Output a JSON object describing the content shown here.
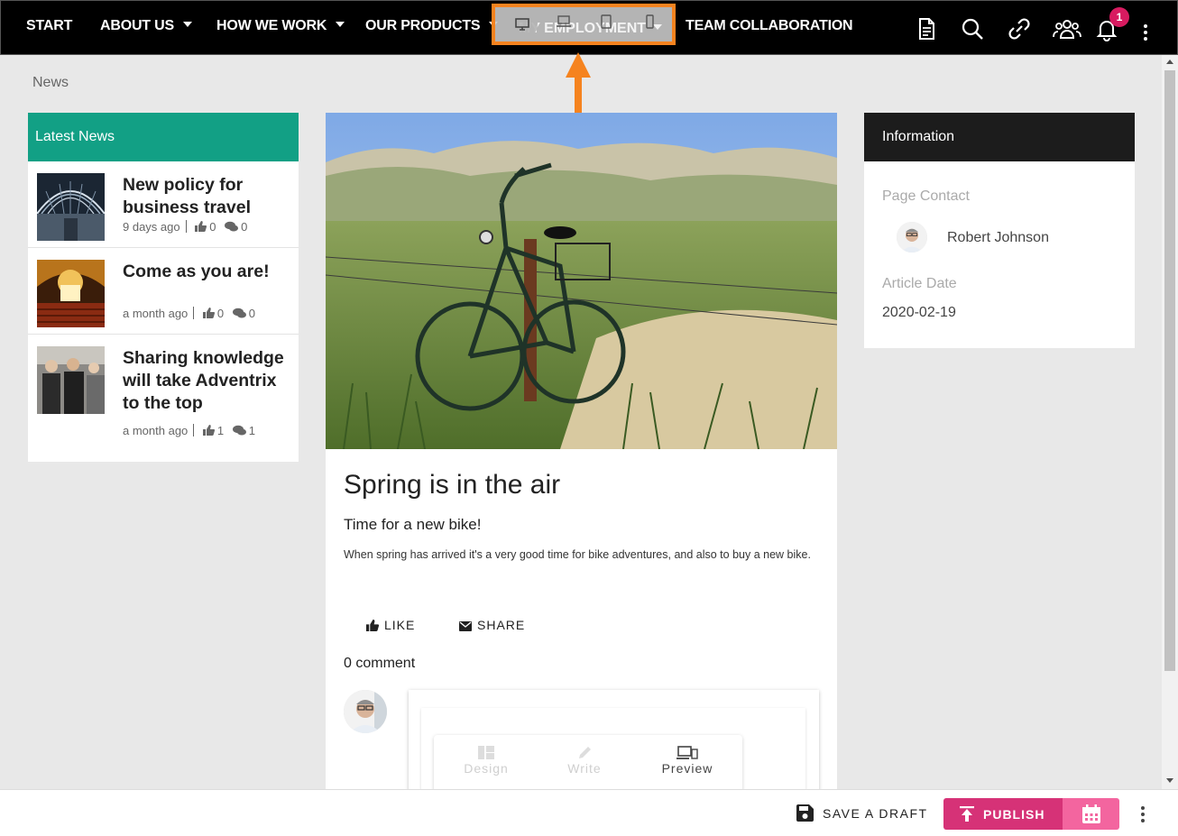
{
  "nav": {
    "items": [
      {
        "label": "START",
        "dropdown": false
      },
      {
        "label": "ABOUT US",
        "dropdown": true
      },
      {
        "label": "HOW WE WORK",
        "dropdown": true
      },
      {
        "label": "OUR PRODUCTS",
        "dropdown": true
      },
      {
        "label": "MY EMPLOYMENT",
        "dropdown": true
      },
      {
        "label": "TEAM COLLABORATION",
        "dropdown": false
      }
    ],
    "notification_count": "1",
    "icons": [
      "document-icon",
      "search-icon",
      "link-icon",
      "people-icon",
      "bell-icon",
      "more-vertical-icon"
    ],
    "device_switcher": [
      "desktop-icon",
      "laptop-icon",
      "tablet-icon",
      "phone-icon"
    ]
  },
  "breadcrumb": "News",
  "latest_news": {
    "title": "Latest News",
    "items": [
      {
        "title": "New policy for business travel",
        "time": "9 days ago",
        "likes": "0",
        "comments": "0"
      },
      {
        "title": "Come as you are!",
        "time": "a month ago",
        "likes": "0",
        "comments": "0"
      },
      {
        "title": "Sharing knowledge will take Adventrix to the top",
        "time": "a month ago",
        "likes": "1",
        "comments": "1"
      }
    ]
  },
  "article": {
    "title": "Spring is in the air",
    "subtitle": "Time for a new bike!",
    "body": "When spring has arrived it's a very good time for bike adventures, and also to buy a new bike.",
    "like_label": "LIKE",
    "share_label": "SHARE",
    "comment_count": "0 comment",
    "editor_tabs": [
      {
        "label": "Design",
        "active": false
      },
      {
        "label": "Write",
        "active": false
      },
      {
        "label": "Preview",
        "active": true
      }
    ]
  },
  "info": {
    "title": "Information",
    "contact_label": "Page Contact",
    "contact_name": "Robert Johnson",
    "date_label": "Article Date",
    "date_value": "2020-02-19"
  },
  "bottom": {
    "draft_label": "SAVE A DRAFT",
    "publish_label": "PUBLISH"
  },
  "colors": {
    "accent_orange": "#f5831f",
    "latest_news_header": "#12a085",
    "publish": "#d63277",
    "schedule": "#f3659f",
    "badge": "#d81b60"
  }
}
